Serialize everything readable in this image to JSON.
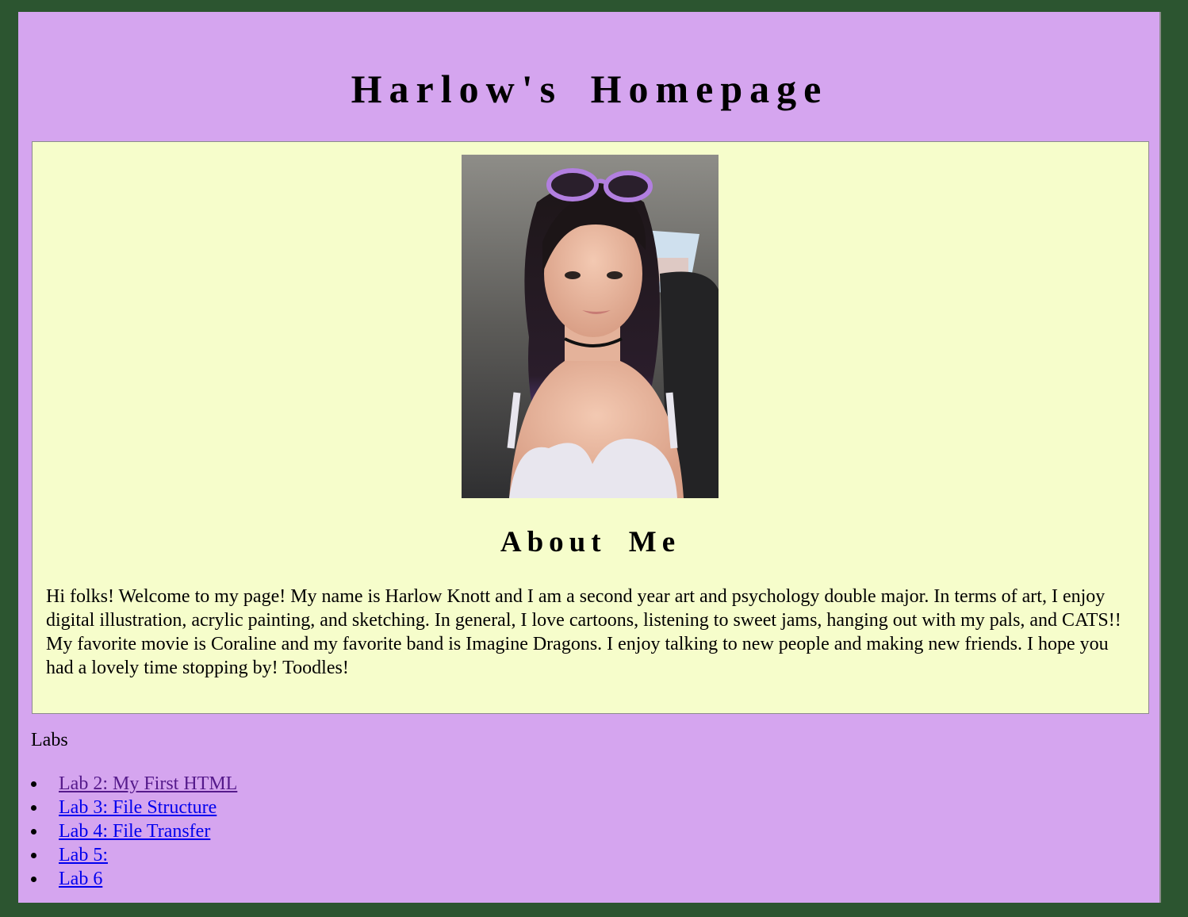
{
  "header": {
    "title": "Harlow's Homepage"
  },
  "about": {
    "photo_icon": "portrait-photo",
    "heading": "About Me",
    "text": "Hi folks! Welcome to my page! My name is Harlow Knott and I am a second year art and psychology double major. In terms of art, I enjoy digital illustration, acrylic painting, and sketching. In general, I love cartoons, listening to sweet jams, hanging out with my pals, and CATS!! My favorite movie is Coraline and my favorite band is Imagine Dragons. I enjoy talking to new people and making new friends. I hope you had a lovely time stopping by! Toodles!"
  },
  "labs": {
    "label": "Labs",
    "items": [
      {
        "label": "Lab 2: My First HTML",
        "visited": true
      },
      {
        "label": "Lab 3: File Structure",
        "visited": false
      },
      {
        "label": "Lab 4: File Transfer",
        "visited": false
      },
      {
        "label": "Lab 5:",
        "visited": false
      },
      {
        "label": "Lab 6",
        "visited": false
      }
    ]
  },
  "colors": {
    "outer_background": "#2c5530",
    "page_background": "#d5a5ef",
    "about_background": "#f6fdcb",
    "link": "#0000ee",
    "link_visited": "#551a8b"
  }
}
